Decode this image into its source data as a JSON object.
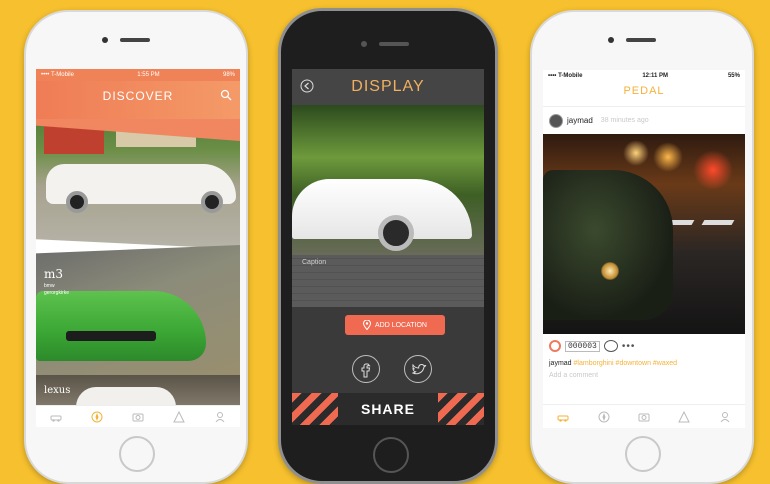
{
  "colors": {
    "background": "#f6c02e",
    "accent_orange": "#f06a52",
    "pedal_yellow": "#f4b23a",
    "display_title": "#f0b060"
  },
  "discover_screen": {
    "status_carrier": "•••• T-Mobile",
    "status_time": "1:55 PM",
    "status_battery": "98%",
    "title": "DISCOVER",
    "search_icon": "search-icon",
    "card_label": "m3",
    "card_sublabel_1": "bmw",
    "card_sublabel_2": "gerorgkirke",
    "card3_label": "lexus",
    "tab_icons": [
      "car-icon",
      "compass-icon",
      "camera-icon",
      "alert-icon",
      "person-icon"
    ]
  },
  "display_screen": {
    "title": "DISPLAY",
    "back_icon": "back-arrow-icon",
    "caption_placeholder": "Caption",
    "add_location_label": "ADD LOCATION",
    "share_label": "SHARE",
    "social_icons": [
      "facebook-icon",
      "twitter-icon"
    ]
  },
  "pedal_screen": {
    "status_carrier": "•••• T-Mobile",
    "status_time": "12:11 PM",
    "status_battery": "55%",
    "title": "PEDAL",
    "username": "jaymad",
    "time_ago": "38 minutes ago",
    "like_count": "000003",
    "caption_user": "jaymad",
    "caption_tags": "#lamborghini #downtown #waxed",
    "add_comment_placeholder": "Add a comment",
    "tab_icons": [
      "car-icon",
      "compass-icon",
      "camera-icon",
      "alert-icon",
      "person-icon"
    ]
  }
}
